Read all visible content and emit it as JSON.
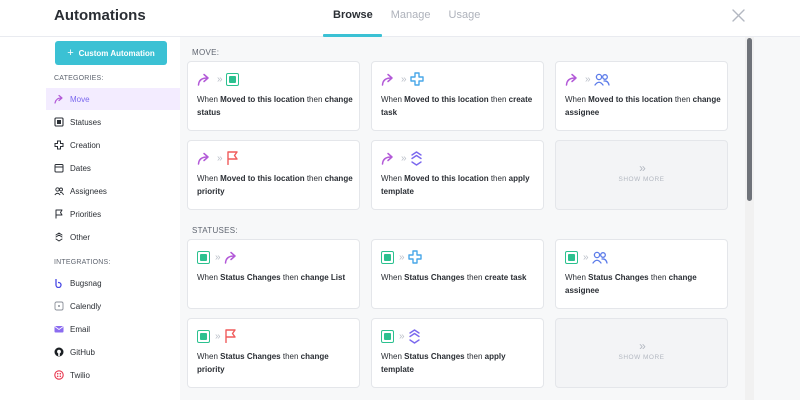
{
  "header": {
    "title": "Automations",
    "tabs": [
      {
        "label": "Browse",
        "active": true
      },
      {
        "label": "Manage",
        "active": false
      },
      {
        "label": "Usage",
        "active": false
      }
    ]
  },
  "sidebar": {
    "custom_button": "Custom Automation",
    "categories_heading": "CATEGORIES:",
    "categories": [
      {
        "label": "Move",
        "icon": "move-icon",
        "active": true
      },
      {
        "label": "Statuses",
        "icon": "status-icon"
      },
      {
        "label": "Creation",
        "icon": "creation-icon"
      },
      {
        "label": "Dates",
        "icon": "calendar-icon"
      },
      {
        "label": "Assignees",
        "icon": "assignees-icon"
      },
      {
        "label": "Priorities",
        "icon": "flag-icon"
      },
      {
        "label": "Other",
        "icon": "template-icon"
      }
    ],
    "integrations_heading": "INTEGRATIONS:",
    "integrations": [
      {
        "label": "Bugsnag",
        "icon": "bugsnag-icon"
      },
      {
        "label": "Calendly",
        "icon": "calendly-icon"
      },
      {
        "label": "Email",
        "icon": "email-icon"
      },
      {
        "label": "GitHub",
        "icon": "github-icon"
      },
      {
        "label": "Twilio",
        "icon": "twilio-icon"
      }
    ]
  },
  "main": {
    "move_label": "MOVE:",
    "move_cards": [
      {
        "when": "When",
        "trigger": "Moved to this location",
        "then": "then",
        "action": "change status"
      },
      {
        "when": "When",
        "trigger": "Moved to this location",
        "then": "then",
        "action": "create task"
      },
      {
        "when": "When",
        "trigger": "Moved to this location",
        "then": "then",
        "action": "change assignee"
      },
      {
        "when": "When",
        "trigger": "Moved to this location",
        "then": "then",
        "action": "change priority"
      },
      {
        "when": "When",
        "trigger": "Moved to this location",
        "then": "then",
        "action": "apply template"
      }
    ],
    "statuses_label": "STATUSES:",
    "status_cards": [
      {
        "when": "When",
        "trigger": "Status Changes",
        "then": "then",
        "action": "change List"
      },
      {
        "when": "When",
        "trigger": "Status Changes",
        "then": "then",
        "action": "create task"
      },
      {
        "when": "When",
        "trigger": "Status Changes",
        "then": "then",
        "action": "change assignee"
      },
      {
        "when": "When",
        "trigger": "Status Changes",
        "then": "then",
        "action": "change priority"
      },
      {
        "when": "When",
        "trigger": "Status Changes",
        "then": "then",
        "action": "apply template"
      }
    ],
    "show_more": "SHOW MORE"
  },
  "colors": {
    "accent": "#3bc1d4",
    "move": "#b35ad8",
    "status": "#2bc18f",
    "create": "#49a7e8",
    "assignee": "#5b7be9",
    "priority": "#f05c5c",
    "template": "#7b68ee"
  }
}
